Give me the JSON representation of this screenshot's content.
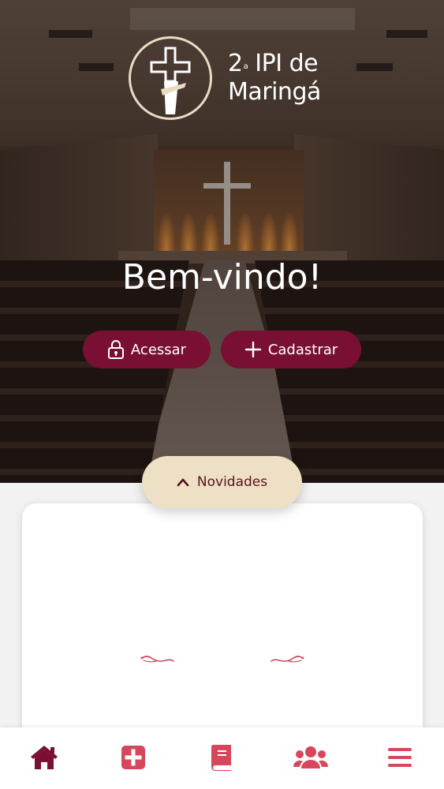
{
  "brand": {
    "name_line1": "2",
    "name_sup": "a",
    "name_line1_rest": " IPI de",
    "name_line2": "Maringá"
  },
  "hero": {
    "welcome": "Bem-vindo!"
  },
  "actions": {
    "access_label": "Acessar",
    "register_label": "Cadastrar"
  },
  "news": {
    "toggle_label": "Novidades"
  },
  "bottom_nav": {
    "items": [
      {
        "icon": "home-icon",
        "active": true
      },
      {
        "icon": "plus-square-icon",
        "active": false
      },
      {
        "icon": "bible-icon",
        "active": false
      },
      {
        "icon": "users-icon",
        "active": false
      },
      {
        "icon": "menu-icon",
        "active": false
      }
    ]
  },
  "colors": {
    "primary": "#7a0f34",
    "active_nav": "#7a0f34",
    "inactive_nav": "#d6475b",
    "pill": "#ede0c4",
    "flourish": "#c74a5c"
  }
}
